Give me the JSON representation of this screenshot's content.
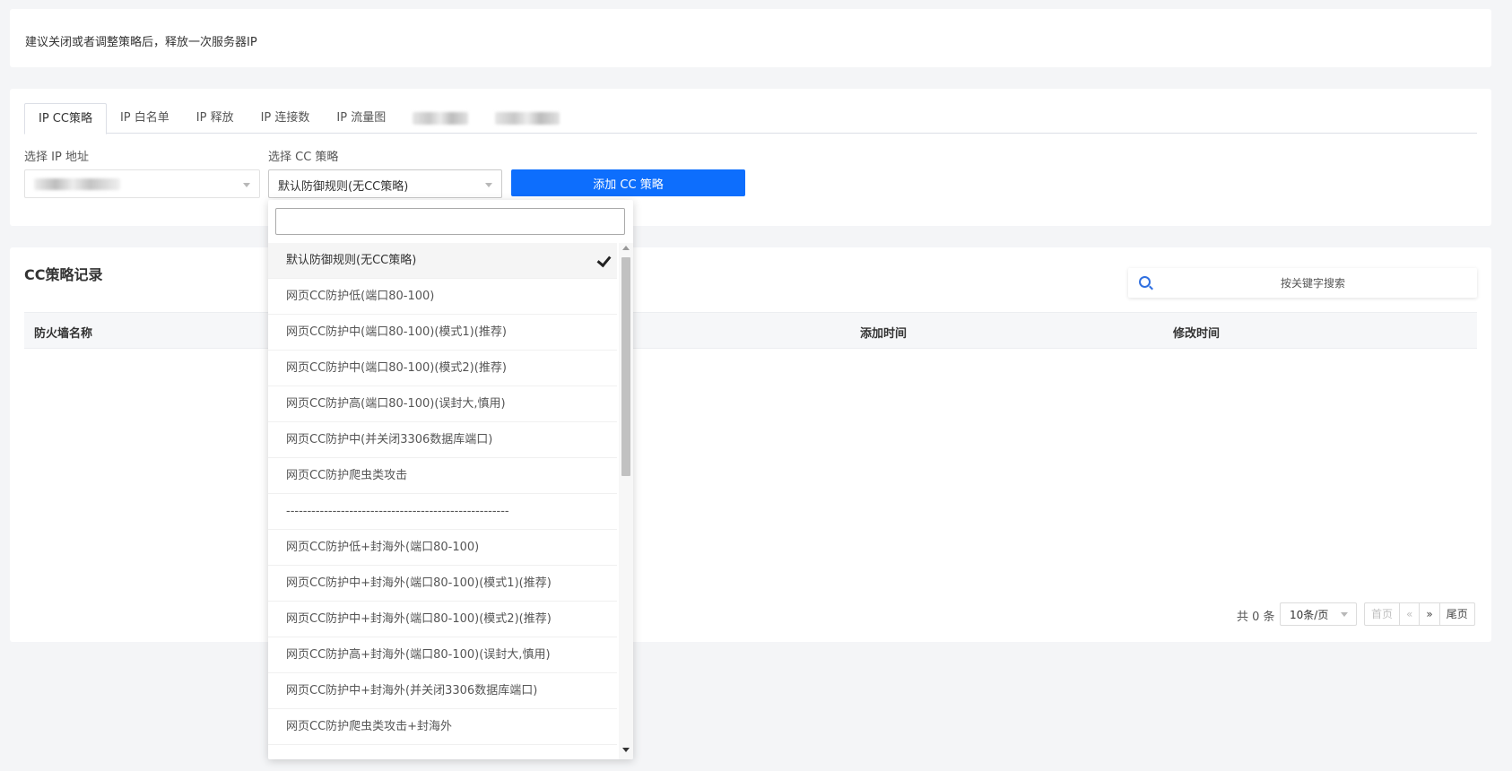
{
  "notice": {
    "text": "建议关闭或者调整策略后，释放一次服务器IP"
  },
  "tabs": [
    {
      "label": "IP CC策略",
      "active": true
    },
    {
      "label": "IP 白名单"
    },
    {
      "label": "IP 释放"
    },
    {
      "label": "IP 连接数"
    },
    {
      "label": "IP 流量图"
    }
  ],
  "form": {
    "ip_label": "选择 IP 地址",
    "cc_label": "选择 CC 策略",
    "cc_selected": "默认防御规则(无CC策略)",
    "add_button": "添加 CC 策略"
  },
  "records": {
    "title": "CC策略记录",
    "search_placeholder": "按关键字搜索",
    "columns": [
      "防火墙名称",
      "添加时间",
      "修改时间"
    ],
    "rows": []
  },
  "pagination": {
    "total": "共 0 条",
    "page_size": "10条/页",
    "first": "首页",
    "prev": "«",
    "next": "»",
    "last": "尾页"
  },
  "dropdown": {
    "search_value": "",
    "options": [
      "默认防御规则(无CC策略)",
      "网页CC防护低(端口80-100)",
      "网页CC防护中(端口80-100)(模式1)(推荐)",
      "网页CC防护中(端口80-100)(模式2)(推荐)",
      "网页CC防护高(端口80-100)(误封大,慎用)",
      "网页CC防护中(并关闭3306数据库端口)",
      "网页CC防护爬虫类攻击",
      "-----------------------------------------------------",
      "网页CC防护低+封海外(端口80-100)",
      "网页CC防护中+封海外(端口80-100)(模式1)(推荐)",
      "网页CC防护中+封海外(端口80-100)(模式2)(推荐)",
      "网页CC防护高+封海外(端口80-100)(误封大,慎用)",
      "网页CC防护中+封海外(并关闭3306数据库端口)",
      "网页CC防护爬虫类攻击+封海外"
    ],
    "selected_index": 0
  },
  "icons": {
    "search": "search-icon",
    "check": "check-icon",
    "caret": "chevron-down-icon"
  },
  "colors": {
    "primary": "#0d6efd",
    "background": "#f4f5f7"
  }
}
